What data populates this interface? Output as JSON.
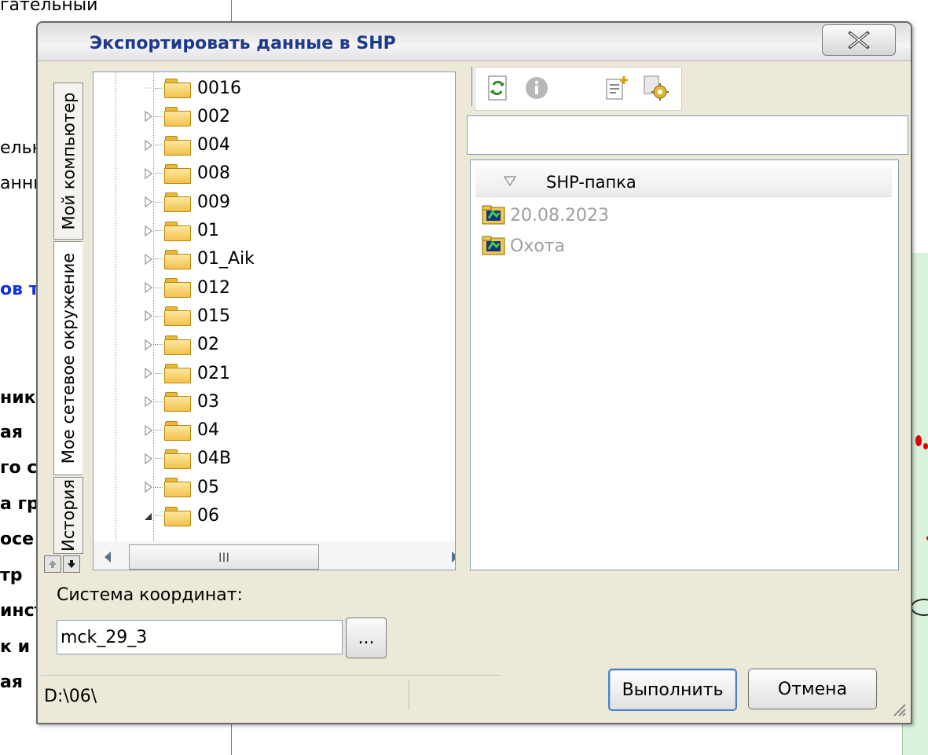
{
  "background": {
    "lines": [
      {
        "text": "гательный",
        "bold": false,
        "blue": false
      },
      {
        "text": "ельн",
        "bold": false,
        "blue": false
      },
      {
        "text": "анны",
        "bold": false,
        "blue": false
      },
      {
        "text": "ов т",
        "bold": true,
        "blue": true
      },
      {
        "text": "ник",
        "bold": true,
        "blue": false
      },
      {
        "text": "ая",
        "bold": true,
        "blue": false
      },
      {
        "text": "го с",
        "bold": true,
        "blue": false
      },
      {
        "text": "а гр",
        "bold": true,
        "blue": false
      },
      {
        "text": "осе",
        "bold": true,
        "blue": false
      },
      {
        "text": "тр",
        "bold": true,
        "blue": false
      },
      {
        "text": "инст",
        "bold": true,
        "blue": false
      },
      {
        "text": "к и",
        "bold": true,
        "blue": false
      },
      {
        "text": "ая",
        "bold": true,
        "blue": false
      }
    ]
  },
  "dialog": {
    "title": "Экспортировать данные в SHP",
    "close_icon": "close-x-icon"
  },
  "tabs": [
    {
      "label": "Мой компьютер",
      "active": false
    },
    {
      "label": "Мое сетевое окружение",
      "active": true
    },
    {
      "label": "История",
      "active": false
    }
  ],
  "tree": {
    "items": [
      {
        "label": "0016",
        "expander": "none"
      },
      {
        "label": "002",
        "expander": "collapsed"
      },
      {
        "label": "004",
        "expander": "collapsed"
      },
      {
        "label": "008",
        "expander": "collapsed"
      },
      {
        "label": "009",
        "expander": "collapsed"
      },
      {
        "label": "01",
        "expander": "collapsed"
      },
      {
        "label": "01_Aik",
        "expander": "collapsed"
      },
      {
        "label": "012",
        "expander": "collapsed"
      },
      {
        "label": "015",
        "expander": "collapsed"
      },
      {
        "label": "02",
        "expander": "collapsed"
      },
      {
        "label": "021",
        "expander": "collapsed"
      },
      {
        "label": "03",
        "expander": "collapsed"
      },
      {
        "label": "04",
        "expander": "collapsed"
      },
      {
        "label": "04B",
        "expander": "collapsed"
      },
      {
        "label": "05",
        "expander": "collapsed"
      },
      {
        "label": "06",
        "expander": "expanded"
      }
    ],
    "hscroll_grip": "III"
  },
  "toolbar": {
    "icons": [
      "refresh-icon",
      "info-icon",
      "new-document-icon",
      "settings-icon"
    ]
  },
  "path_input": {
    "value": ""
  },
  "list": {
    "column_header": "SHP-папка",
    "items": [
      {
        "label": "20.08.2023",
        "icon": "shp-folder-icon"
      },
      {
        "label": "Охота",
        "icon": "shp-folder-icon"
      }
    ]
  },
  "coordinates": {
    "label": "Система координат:",
    "value": "mck_29_3",
    "browse_label": "..."
  },
  "status": {
    "path": "D:\\06\\"
  },
  "buttons": {
    "execute": "Выполнить",
    "cancel": "Отмена"
  },
  "colors": {
    "title": "#1d3a8a",
    "accent_border": "#4a7fc7",
    "disabled_text": "#9e9e9e"
  }
}
